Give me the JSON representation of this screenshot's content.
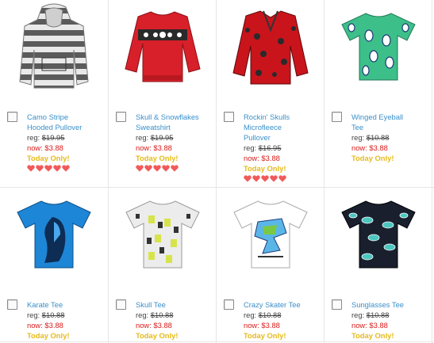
{
  "colors": {
    "link": "#3a8fc9",
    "price_now": "#d91a1a",
    "today_only": "#e6ba1a",
    "heart": "#f15a5a",
    "grid_line": "#e6e6e6"
  },
  "products": [
    {
      "name_lines": [
        "Camo Stripe",
        "Hooded Pullover"
      ],
      "reg_label": "reg:",
      "reg_price": "$19.95",
      "now_label": "now:",
      "now_price": "$3.88",
      "badge": "Today Only!",
      "rating_hearts": 5,
      "icon": "hoodie-icon"
    },
    {
      "name_lines": [
        "Skull & Snowflakes",
        "Sweatshirt"
      ],
      "reg_label": "reg:",
      "reg_price": "$19.95",
      "now_label": "now:",
      "now_price": "$3.88",
      "badge": "Today Only!",
      "rating_hearts": 5,
      "icon": "sweatshirt-icon"
    },
    {
      "name_lines": [
        "Rockin' Skulls",
        "Microfleece",
        "Pullover"
      ],
      "reg_label": "reg:",
      "reg_price": "$16.95",
      "now_label": "now:",
      "now_price": "$3.88",
      "badge": "Today Only!",
      "rating_hearts": 5,
      "icon": "fleece-icon"
    },
    {
      "name_lines": [
        "Winged Eyeball",
        "Tee"
      ],
      "reg_label": "reg:",
      "reg_price": "$10.88",
      "now_label": "now:",
      "now_price": "$3.88",
      "badge": "Today Only!",
      "rating_hearts": 0,
      "icon": "tee-icon"
    },
    {
      "name_lines": [
        "Karate Tee"
      ],
      "reg_label": "reg:",
      "reg_price": "$10.88",
      "now_label": "now:",
      "now_price": "$3.88",
      "badge": "Today Only!",
      "rating_hearts": 0,
      "icon": "tee-icon"
    },
    {
      "name_lines": [
        "Skull Tee"
      ],
      "reg_label": "reg:",
      "reg_price": "$10.88",
      "now_label": "now:",
      "now_price": "$3.88",
      "badge": "Today Only!",
      "rating_hearts": 0,
      "icon": "tee-icon"
    },
    {
      "name_lines": [
        "Crazy Skater Tee"
      ],
      "reg_label": "reg:",
      "reg_price": "$10.88",
      "now_label": "now:",
      "now_price": "$3.88",
      "badge": "Today Only!",
      "rating_hearts": 0,
      "icon": "tee-icon"
    },
    {
      "name_lines": [
        "Sunglasses Tee"
      ],
      "reg_label": "reg:",
      "reg_price": "$10.88",
      "now_label": "now:",
      "now_price": "$3.88",
      "badge": "Today Only!",
      "rating_hearts": 0,
      "icon": "tee-icon"
    }
  ]
}
